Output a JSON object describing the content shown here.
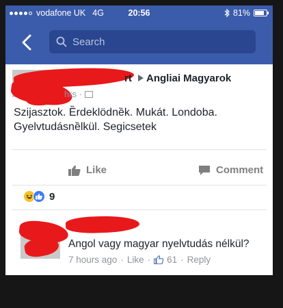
{
  "status_bar": {
    "carrier": "vodafone UK",
    "network": "4G",
    "time": "20:56",
    "battery": "81%",
    "battery_level": 0.81
  },
  "nav": {
    "search_placeholder": "Search",
    "back_icon": "chevron-left-icon",
    "search_icon": "search-icon"
  },
  "post": {
    "author_suffix": "rt",
    "group": "Angliai Magyarok",
    "time": "hrs ·",
    "text_line1": "Szijasztok. Ȅrdeklödnȅk. Mukát.   Londoba.",
    "text_line2": "Gyelvtudásnȅlkül. Segicsetek"
  },
  "actions": {
    "like_label": "Like",
    "comment_label": "Comment"
  },
  "reactions": {
    "count": "9"
  },
  "comment": {
    "text": "Angol vagy magyar nyelvtudás nélkül?",
    "time": "7 hours ago",
    "like": "Like",
    "like_count": "61",
    "reply": "Reply"
  },
  "colors": {
    "facebook_blue": "#3b5bab",
    "redaction": "#e8191b",
    "like_blue": "#3f7bf1"
  }
}
